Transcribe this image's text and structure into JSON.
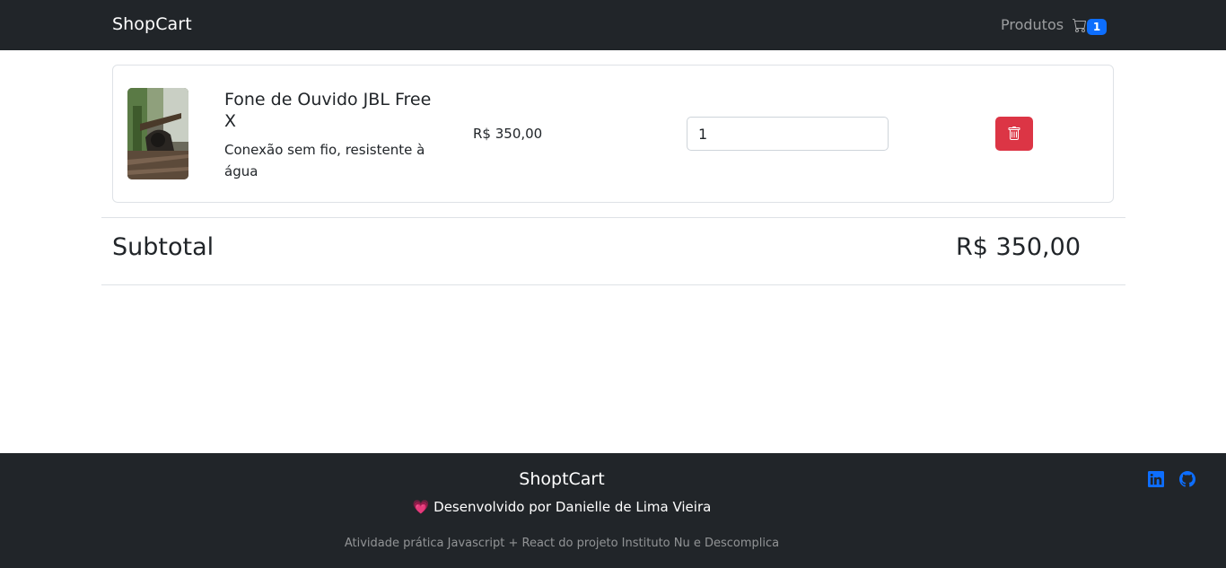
{
  "navbar": {
    "brand": "ShopCart",
    "products_link": "Produtos",
    "cart_count": "1"
  },
  "cart": {
    "items": [
      {
        "title": "Fone de Ouvido JBL Free X",
        "description": "Conexão sem fio, resistente à água",
        "price": "R$ 350,00",
        "quantity": "1"
      }
    ]
  },
  "subtotal": {
    "label": "Subtotal",
    "value": "R$ 350,00"
  },
  "footer": {
    "brand": "ShoptCart",
    "heart": "💗",
    "developer": "Desenvolvido por Danielle de Lima Vieira",
    "note": "Atividade prática Javascript + React do projeto Instituto Nu e Descomplica"
  },
  "icons": {
    "cart": "cart-icon",
    "trash": "trash-icon",
    "linkedin": "linkedin-icon",
    "github": "github-icon"
  },
  "colors": {
    "navbar": "#212529",
    "badge": "#0d6efd",
    "danger": "#dc3545",
    "social": "#0d6efd"
  }
}
